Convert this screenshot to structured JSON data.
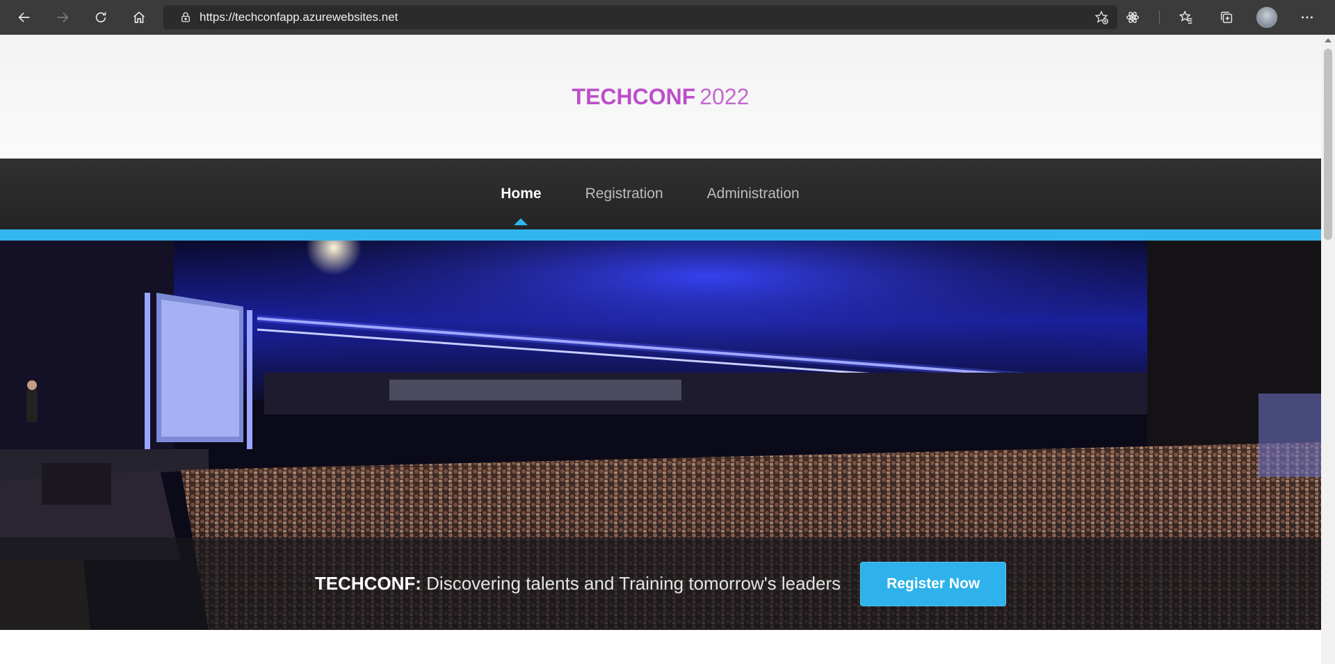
{
  "browser": {
    "url": "https://techconfapp.azurewebsites.net"
  },
  "site": {
    "brand_name": "TECHCONF",
    "brand_year": "2022"
  },
  "nav": {
    "items": [
      {
        "label": "Home",
        "active": true
      },
      {
        "label": "Registration",
        "active": false
      },
      {
        "label": "Administration",
        "active": false
      }
    ]
  },
  "hero": {
    "tagline_strong": "TECHCONF:",
    "tagline_rest": " Discovering talents and Training tomorrow's leaders",
    "register_label": "Register Now"
  },
  "colors": {
    "brand": "#bc4fca",
    "accent": "#33b6ee",
    "navbar": "#2a2a2a"
  },
  "icons": [
    "back-icon",
    "forward-icon",
    "refresh-icon",
    "home-icon",
    "lock-icon",
    "add-favorite-icon",
    "extension-icon",
    "favorites-icon",
    "collections-icon",
    "avatar",
    "more-icon"
  ]
}
